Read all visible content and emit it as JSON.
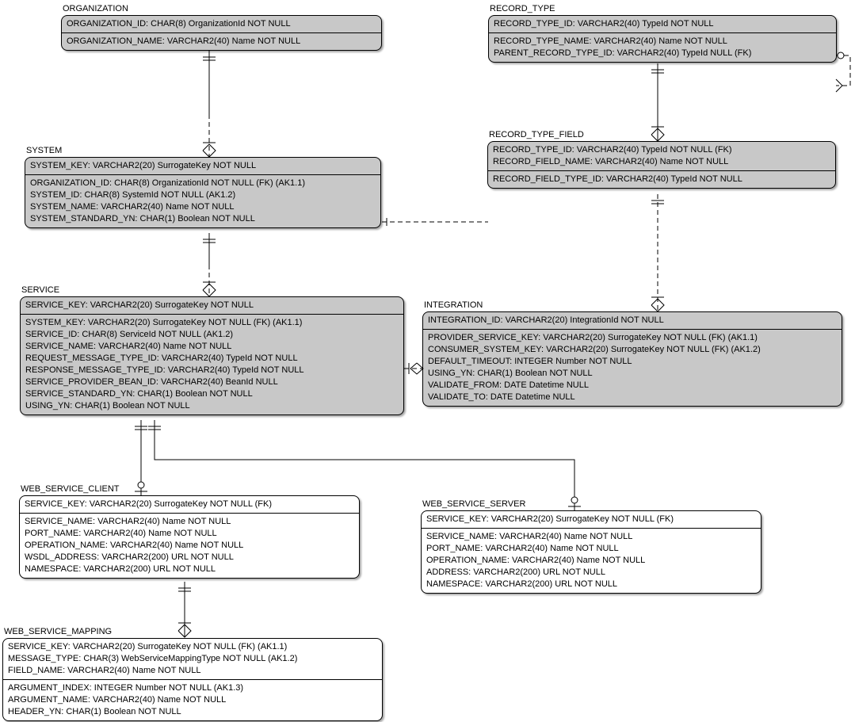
{
  "entities": {
    "organization": {
      "name": "ORGANIZATION",
      "pk": [
        "ORGANIZATION_ID: CHAR(8) OrganizationId NOT NULL"
      ],
      "attrs": [
        "ORGANIZATION_NAME: VARCHAR2(40) Name NOT NULL"
      ]
    },
    "system": {
      "name": "SYSTEM",
      "pk": [
        "SYSTEM_KEY: VARCHAR2(20) SurrogateKey NOT NULL"
      ],
      "attrs": [
        "ORGANIZATION_ID: CHAR(8) OrganizationId NOT NULL (FK) (AK1.1)",
        "SYSTEM_ID: CHAR(8) SystemId NOT NULL (AK1.2)",
        "SYSTEM_NAME: VARCHAR2(40) Name NOT NULL",
        "SYSTEM_STANDARD_YN: CHAR(1) Boolean NOT NULL"
      ]
    },
    "service": {
      "name": "SERVICE",
      "pk": [
        "SERVICE_KEY: VARCHAR2(20) SurrogateKey NOT NULL"
      ],
      "attrs": [
        "SYSTEM_KEY: VARCHAR2(20) SurrogateKey NOT NULL (FK) (AK1.1)",
        "SERVICE_ID: CHAR(8) ServiceId NOT NULL (AK1.2)",
        "SERVICE_NAME: VARCHAR2(40) Name NOT NULL",
        "REQUEST_MESSAGE_TYPE_ID: VARCHAR2(40) TypeId NOT NULL",
        "RESPONSE_MESSAGE_TYPE_ID: VARCHAR2(40) TypeId NOT NULL",
        "SERVICE_PROVIDER_BEAN_ID: VARCHAR2(40) BeanId NULL",
        "SERVICE_STANDARD_YN: CHAR(1) Boolean NOT NULL",
        "USING_YN: CHAR(1) Boolean NOT NULL"
      ]
    },
    "web_service_client": {
      "name": "WEB_SERVICE_CLIENT",
      "pk": [
        "SERVICE_KEY: VARCHAR2(20) SurrogateKey NOT NULL (FK)"
      ],
      "attrs": [
        "SERVICE_NAME: VARCHAR2(40) Name NOT NULL",
        "PORT_NAME: VARCHAR2(40) Name NOT NULL",
        "OPERATION_NAME: VARCHAR2(40) Name NOT NULL",
        "WSDL_ADDRESS: VARCHAR2(200) URL NOT NULL",
        "NAMESPACE: VARCHAR2(200) URL NOT NULL"
      ]
    },
    "web_service_mapping": {
      "name": "WEB_SERVICE_MAPPING",
      "pk": [
        "SERVICE_KEY: VARCHAR2(20) SurrogateKey NOT NULL (FK) (AK1.1)",
        "MESSAGE_TYPE: CHAR(3) WebServiceMappingType NOT NULL (AK1.2)",
        "FIELD_NAME: VARCHAR2(40) Name NOT NULL"
      ],
      "attrs": [
        "ARGUMENT_INDEX: INTEGER Number NOT NULL (AK1.3)",
        "ARGUMENT_NAME: VARCHAR2(40) Name NOT NULL",
        "HEADER_YN: CHAR(1) Boolean NOT NULL"
      ]
    },
    "record_type": {
      "name": "RECORD_TYPE",
      "pk": [
        "RECORD_TYPE_ID: VARCHAR2(40) TypeId NOT NULL"
      ],
      "attrs": [
        "RECORD_TYPE_NAME: VARCHAR2(40) Name NOT NULL",
        "PARENT_RECORD_TYPE_ID: VARCHAR2(40) TypeId NULL (FK)"
      ]
    },
    "record_type_field": {
      "name": "RECORD_TYPE_FIELD",
      "pk": [
        "RECORD_TYPE_ID: VARCHAR2(40) TypeId NOT NULL (FK)",
        "RECORD_FIELD_NAME: VARCHAR2(40) Name NOT NULL"
      ],
      "attrs": [
        "RECORD_FIELD_TYPE_ID: VARCHAR2(40) TypeId NOT NULL"
      ]
    },
    "integration": {
      "name": "INTEGRATION",
      "pk": [
        "INTEGRATION_ID: VARCHAR2(20) IntegrationId NOT NULL"
      ],
      "attrs": [
        "PROVIDER_SERVICE_KEY: VARCHAR2(20) SurrogateKey NOT NULL (FK) (AK1.1)",
        "CONSUMER_SYSTEM_KEY: VARCHAR2(20) SurrogateKey NOT NULL (FK) (AK1.2)",
        "DEFAULT_TIMEOUT: INTEGER Number NOT NULL",
        "USING_YN: CHAR(1) Boolean NOT NULL",
        "VALIDATE_FROM: DATE Datetime NULL",
        "VALIDATE_TO: DATE Datetime NULL"
      ]
    },
    "web_service_server": {
      "name": "WEB_SERVICE_SERVER",
      "pk": [
        "SERVICE_KEY: VARCHAR2(20) SurrogateKey NOT NULL (FK)"
      ],
      "attrs": [
        "SERVICE_NAME: VARCHAR2(40) Name NOT NULL",
        "PORT_NAME: VARCHAR2(40) Name NOT NULL",
        "OPERATION_NAME: VARCHAR2(40) Name NOT NULL",
        "ADDRESS: VARCHAR2(200) URL NOT NULL",
        "NAMESPACE: VARCHAR2(200) URL NOT NULL"
      ]
    }
  }
}
